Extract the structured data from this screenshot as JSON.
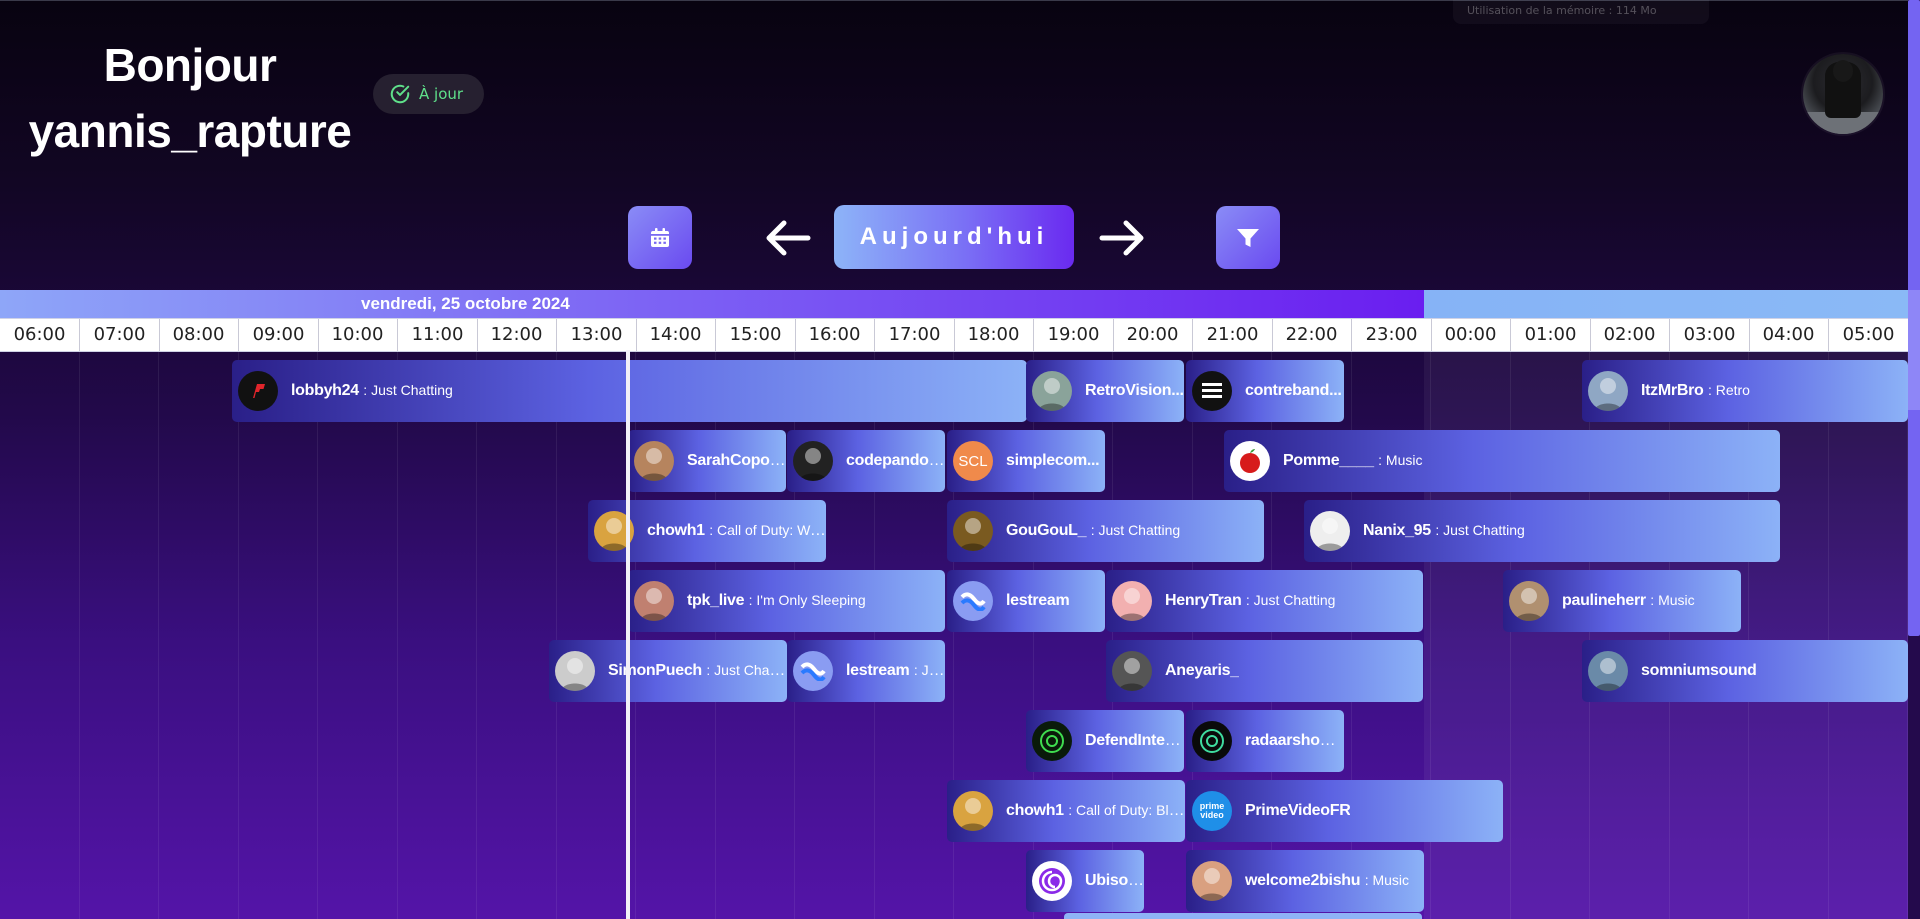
{
  "memory_tip": "Utilisation de la mémoire : 114 Mo",
  "greeting": {
    "line1": "Bonjour",
    "line2": "yannis_rapture"
  },
  "status": {
    "label": "À jour",
    "color": "#5fe08a"
  },
  "nav": {
    "calendar_icon": "calendar-icon",
    "prev_icon": "arrow-left-icon",
    "today_label": "Aujourd'hui",
    "next_icon": "arrow-right-icon",
    "filter_icon": "filter-icon"
  },
  "date_label": "vendredi, 25 octobre 2024",
  "hours": [
    "06:00",
    "07:00",
    "08:00",
    "09:00",
    "10:00",
    "11:00",
    "12:00",
    "13:00",
    "14:00",
    "15:00",
    "16:00",
    "17:00",
    "18:00",
    "19:00",
    "20:00",
    "21:00",
    "22:00",
    "23:00",
    "00:00",
    "01:00",
    "02:00",
    "03:00",
    "04:00",
    "05:00"
  ],
  "events": [
    {
      "name": "lobbyh24",
      "category": ": Just Chatting"
    },
    {
      "name": "RetroVision...",
      "category": ""
    },
    {
      "name": "contreband...",
      "category": ""
    },
    {
      "name": "ItzMrBro",
      "category": ": Retro"
    },
    {
      "name": "SarahCopon...",
      "category": ""
    },
    {
      "name": "codepandor...",
      "category": ""
    },
    {
      "name": "simplecom...",
      "category": "",
      "avatar_text": "SCL"
    },
    {
      "name": "Pomme____",
      "category": ": Music"
    },
    {
      "name": "chowh1",
      "category": ": Call of Duty: War..."
    },
    {
      "name": "GouGouL_",
      "category": ": Just Chatting"
    },
    {
      "name": "Nanix_95",
      "category": ": Just Chatting"
    },
    {
      "name": "tpk_live",
      "category": ": I'm Only Sleeping"
    },
    {
      "name": "lestream",
      "category": ""
    },
    {
      "name": "HenryTran",
      "category": ": Just Chatting"
    },
    {
      "name": "paulineherr",
      "category": ": Music"
    },
    {
      "name": "SimonPuech",
      "category": ": Just Chatti..."
    },
    {
      "name": "lestream",
      "category": ": Jus..."
    },
    {
      "name": "Aneyaris_",
      "category": ""
    },
    {
      "name": "somniumsound",
      "category": ""
    },
    {
      "name": "DefendIntell...",
      "category": ""
    },
    {
      "name": "radaarshow",
      "category": ": ..."
    },
    {
      "name": "chowh1",
      "category": ": Call of Duty: Blac..."
    },
    {
      "name": "PrimeVideoFR",
      "category": "",
      "avatar_text": "prime video"
    },
    {
      "name": "Ubisof...",
      "category": ""
    },
    {
      "name": "welcome2bishu",
      "category": ": Music"
    }
  ],
  "colors": {
    "accent": "#6a2af0",
    "today_gradient_start": "#8db4f8",
    "event_gradient_start": "#2a1f88",
    "event_gradient_end": "#8cb2f7"
  }
}
